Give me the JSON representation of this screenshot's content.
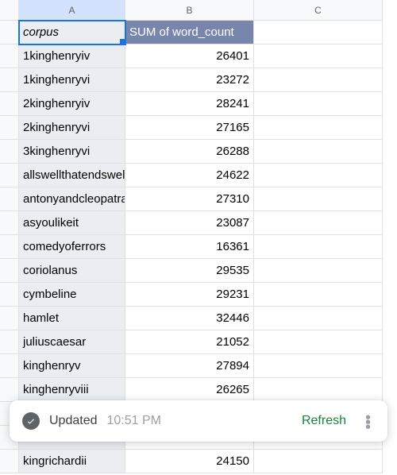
{
  "columns": {
    "a": "A",
    "b": "B",
    "c": "C"
  },
  "pivot_headers": {
    "a": "corpus",
    "b": "SUM of word_count"
  },
  "rows": [
    {
      "corpus": "1kinghenryiv",
      "sum": "26401"
    },
    {
      "corpus": "1kinghenryvi",
      "sum": "23272"
    },
    {
      "corpus": "2kinghenryiv",
      "sum": "28241"
    },
    {
      "corpus": "2kinghenryvi",
      "sum": "27165"
    },
    {
      "corpus": "3kinghenryvi",
      "sum": "26288"
    },
    {
      "corpus": "allswellthatendswell",
      "sum": "24622"
    },
    {
      "corpus": "antonyandcleopatra",
      "sum": "27310"
    },
    {
      "corpus": "asyoulikeit",
      "sum": "23087"
    },
    {
      "corpus": "comedyoferrors",
      "sum": "16361"
    },
    {
      "corpus": "coriolanus",
      "sum": "29535"
    },
    {
      "corpus": "cymbeline",
      "sum": "29231"
    },
    {
      "corpus": "hamlet",
      "sum": "32446"
    },
    {
      "corpus": "juliuscaesar",
      "sum": "21052"
    },
    {
      "corpus": "kinghenryv",
      "sum": "27894"
    },
    {
      "corpus": "kinghenryviii",
      "sum": "26265"
    },
    {
      "corpus": "",
      "sum": ""
    },
    {
      "corpus": "",
      "sum": ""
    },
    {
      "corpus": "kingrichardii",
      "sum": "24150"
    }
  ],
  "toast": {
    "label": "Updated",
    "time": "10:51 PM",
    "refresh": "Refresh"
  }
}
